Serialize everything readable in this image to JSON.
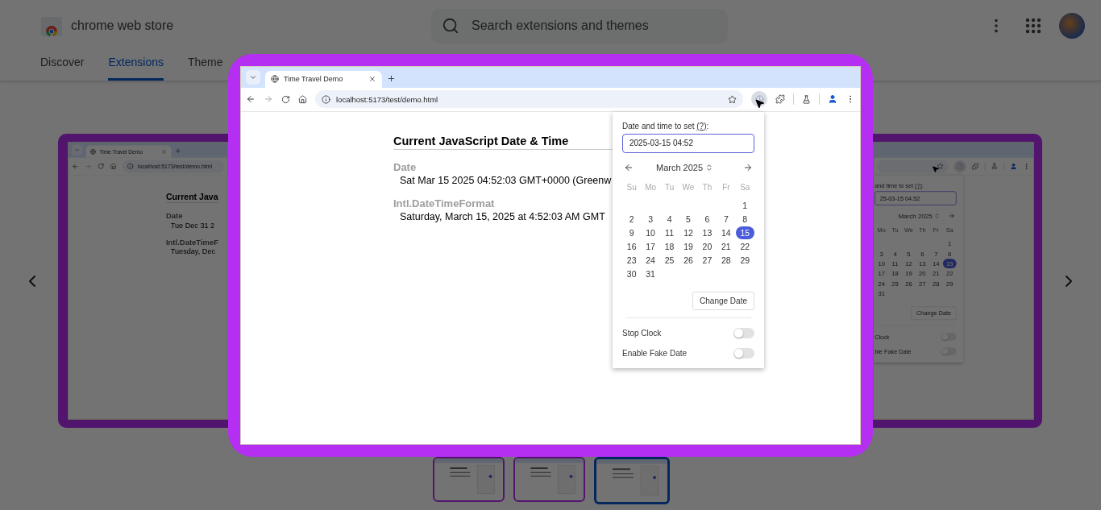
{
  "header": {
    "logo_text": "chrome web store",
    "search": {
      "placeholder": "Search extensions and themes"
    },
    "tabs": [
      {
        "label": "Discover",
        "selected": false
      },
      {
        "label": "Extensions",
        "selected": true
      },
      {
        "label": "Theme",
        "selected": false
      }
    ]
  },
  "carousel": {
    "left_slide": {
      "tab_title": "Time Travel Demo",
      "url": "localhost:5173/test/demo.html",
      "heading": "Current Java",
      "sections": [
        {
          "label": "Date",
          "value": "Tue Dec 31 2"
        },
        {
          "label": "Intl.DateTimeF",
          "value": "Tuesday, Dec"
        }
      ]
    },
    "right_slide": {
      "popup": {
        "label": "and time to set",
        "help_link": "(?)",
        "label_suffix": ":",
        "input_value": "25-03-15 04:52",
        "month": "March 2025",
        "weekdays": [
          "Mo",
          "Tu",
          "We",
          "Th",
          "Fr",
          "Sa"
        ],
        "weeks": [
          {
            "kind": "lead",
            "days": [
              {
                "d": "1",
                "selected": false
              }
            ]
          },
          {
            "kind": "full",
            "days": [
              {
                "d": "3",
                "selected": false
              },
              {
                "d": "4",
                "selected": false
              },
              {
                "d": "5",
                "selected": false
              },
              {
                "d": "6",
                "selected": false
              },
              {
                "d": "7",
                "selected": false
              },
              {
                "d": "8",
                "selected": false
              }
            ]
          },
          {
            "kind": "full",
            "days": [
              {
                "d": "10",
                "selected": false
              },
              {
                "d": "11",
                "selected": false
              },
              {
                "d": "12",
                "selected": false
              },
              {
                "d": "13",
                "selected": false
              },
              {
                "d": "14",
                "selected": false
              },
              {
                "d": "15",
                "selected": true
              }
            ]
          },
          {
            "kind": "full",
            "days": [
              {
                "d": "17",
                "selected": false
              },
              {
                "d": "18",
                "selected": false
              },
              {
                "d": "19",
                "selected": false
              },
              {
                "d": "20",
                "selected": false
              },
              {
                "d": "21",
                "selected": false
              },
              {
                "d": "22",
                "selected": false
              }
            ]
          },
          {
            "kind": "full",
            "days": [
              {
                "d": "24",
                "selected": false
              },
              {
                "d": "25",
                "selected": false
              },
              {
                "d": "26",
                "selected": false
              },
              {
                "d": "27",
                "selected": false
              },
              {
                "d": "28",
                "selected": false
              },
              {
                "d": "29",
                "selected": false
              }
            ]
          },
          {
            "kind": "trail",
            "days": [
              {
                "d": "31",
                "selected": false
              }
            ]
          }
        ],
        "button": "Change Date",
        "toggles": [
          {
            "label": "Clock",
            "on": false
          },
          {
            "label": "ble Fake Date",
            "on": false
          }
        ]
      }
    },
    "thumbnails": [
      {
        "selected": false
      },
      {
        "selected": false
      },
      {
        "selected": true
      }
    ]
  },
  "lightbox": {
    "tab_title": "Time Travel Demo",
    "url": "localhost:5173/test/demo.html",
    "page": {
      "heading": "Current JavaScript Date & Time",
      "sections": [
        {
          "label": "Date",
          "value": "Sat Mar 15 2025 04:52:03 GMT+0000 (Greenw"
        },
        {
          "label": "Intl.DateTimeFormat",
          "value": "Saturday, March 15, 2025 at 4:52:03 AM GMT"
        }
      ]
    },
    "popup": {
      "label": "Date and time to set",
      "help_link": "(?)",
      "label_suffix": ":",
      "input_value": "2025-03-15 04:52",
      "month": "March 2025",
      "weekdays": [
        "Su",
        "Mo",
        "Tu",
        "We",
        "Th",
        "Fr",
        "Sa"
      ],
      "weeks": [
        {
          "kind": "lead",
          "days": [
            {
              "d": "1",
              "selected": false
            }
          ]
        },
        {
          "kind": "full",
          "days": [
            {
              "d": "2",
              "selected": false
            },
            {
              "d": "3",
              "selected": false
            },
            {
              "d": "4",
              "selected": false
            },
            {
              "d": "5",
              "selected": false
            },
            {
              "d": "6",
              "selected": false
            },
            {
              "d": "7",
              "selected": false
            },
            {
              "d": "8",
              "selected": false
            }
          ]
        },
        {
          "kind": "full",
          "days": [
            {
              "d": "9",
              "selected": false
            },
            {
              "d": "10",
              "selected": false
            },
            {
              "d": "11",
              "selected": false
            },
            {
              "d": "12",
              "selected": false
            },
            {
              "d": "13",
              "selected": false
            },
            {
              "d": "14",
              "selected": false
            },
            {
              "d": "15",
              "selected": true
            }
          ]
        },
        {
          "kind": "full",
          "days": [
            {
              "d": "16",
              "selected": false
            },
            {
              "d": "17",
              "selected": false
            },
            {
              "d": "18",
              "selected": false
            },
            {
              "d": "19",
              "selected": false
            },
            {
              "d": "20",
              "selected": false
            },
            {
              "d": "21",
              "selected": false
            },
            {
              "d": "22",
              "selected": false
            }
          ]
        },
        {
          "kind": "full",
          "days": [
            {
              "d": "23",
              "selected": false
            },
            {
              "d": "24",
              "selected": false
            },
            {
              "d": "25",
              "selected": false
            },
            {
              "d": "26",
              "selected": false
            },
            {
              "d": "27",
              "selected": false
            },
            {
              "d": "28",
              "selected": false
            },
            {
              "d": "29",
              "selected": false
            }
          ]
        },
        {
          "kind": "trail",
          "days": [
            {
              "d": "30",
              "selected": false
            },
            {
              "d": "31",
              "selected": false
            }
          ]
        }
      ],
      "button": "Change Date",
      "toggles": [
        {
          "label": "Stop Clock",
          "on": false
        },
        {
          "label": "Enable Fake Date",
          "on": false
        }
      ]
    }
  }
}
